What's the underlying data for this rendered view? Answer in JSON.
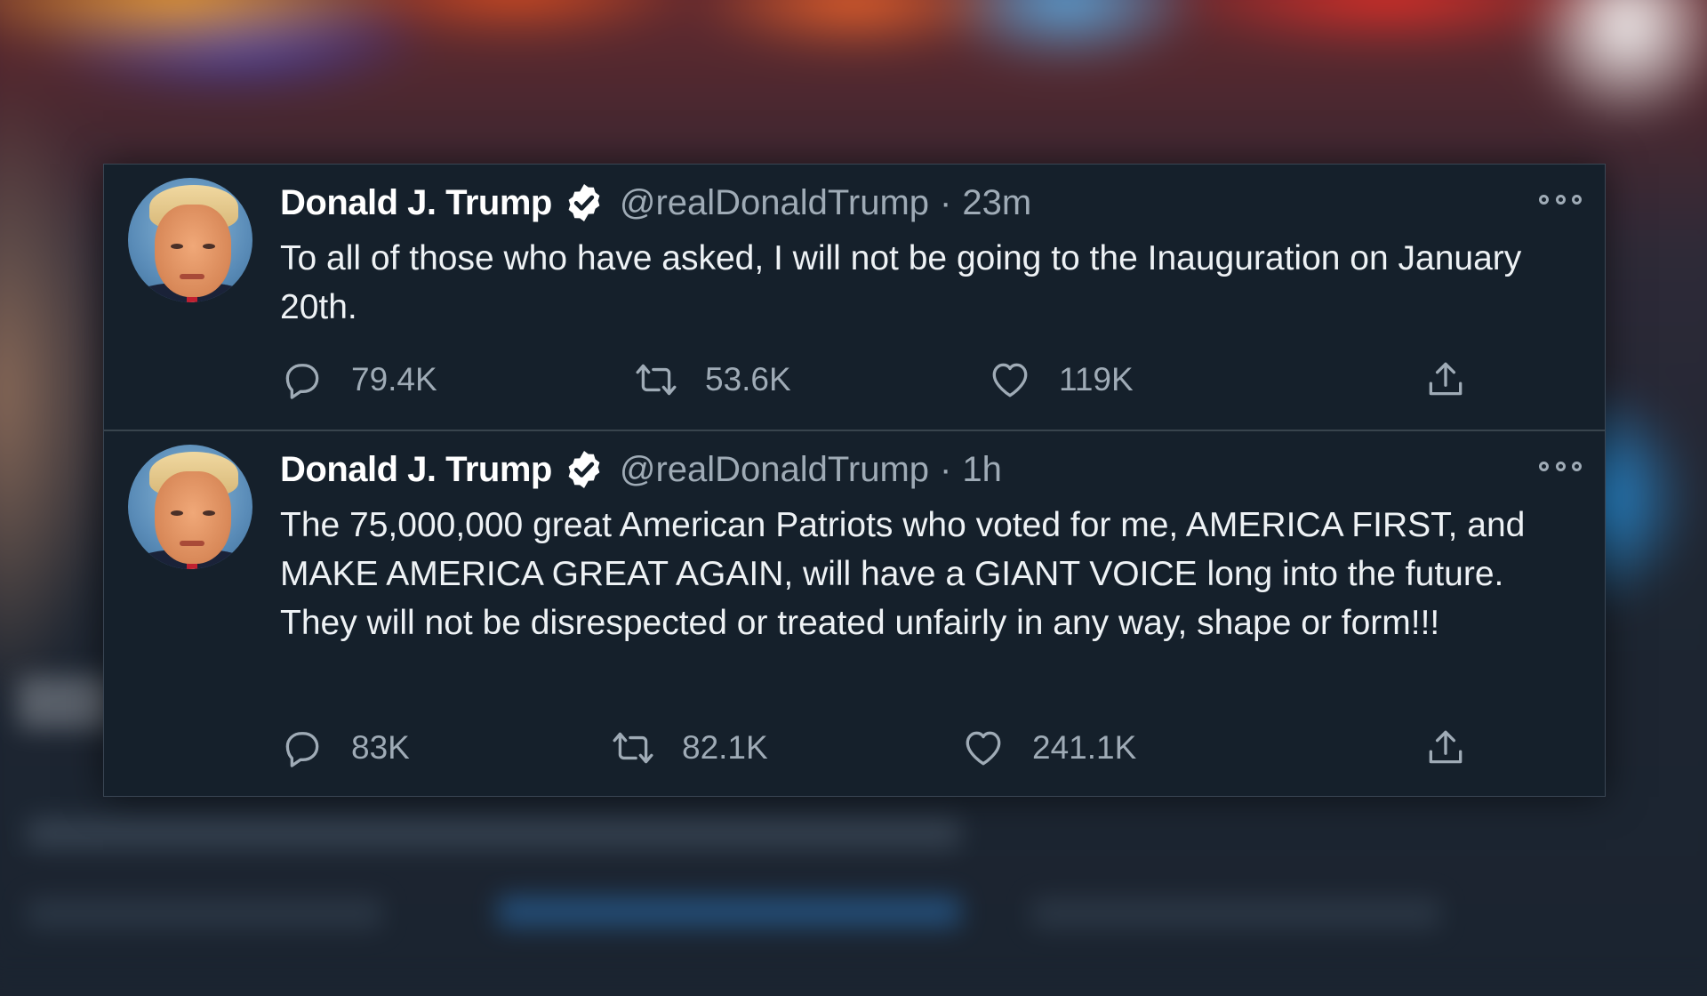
{
  "tweets": [
    {
      "author": {
        "name": "Donald J. Trump",
        "handle": "@realDonaldTrump",
        "verified": true
      },
      "separator": "·",
      "time": "23m",
      "text": "To all of those who have asked, I will not be going to the Inauguration on January 20th.",
      "stats": {
        "replies": "79.4K",
        "retweets": "53.6K",
        "likes": "119K"
      }
    },
    {
      "author": {
        "name": "Donald J. Trump",
        "handle": "@realDonaldTrump",
        "verified": true
      },
      "separator": "·",
      "time": "1h",
      "text": "The 75,000,000 great American Patriots who voted for me, AMERICA FIRST, and MAKE AMERICA GREAT AGAIN, will have a GIANT VOICE long into the future. They will not be disrespected or treated unfairly in any way, shape or form!!!",
      "stats": {
        "replies": "83K",
        "retweets": "82.1K",
        "likes": "241.1K"
      }
    }
  ],
  "icons": {
    "reply": "speech-bubble",
    "retweet": "retweet-arrows",
    "like": "heart",
    "share": "upload-arrow",
    "more": "three-dots",
    "verified": "check-badge"
  },
  "colors": {
    "card_background": "#15202b",
    "primary_text": "#eef2f5",
    "secondary_text": "#9fabb6",
    "divider": "#38444d"
  }
}
